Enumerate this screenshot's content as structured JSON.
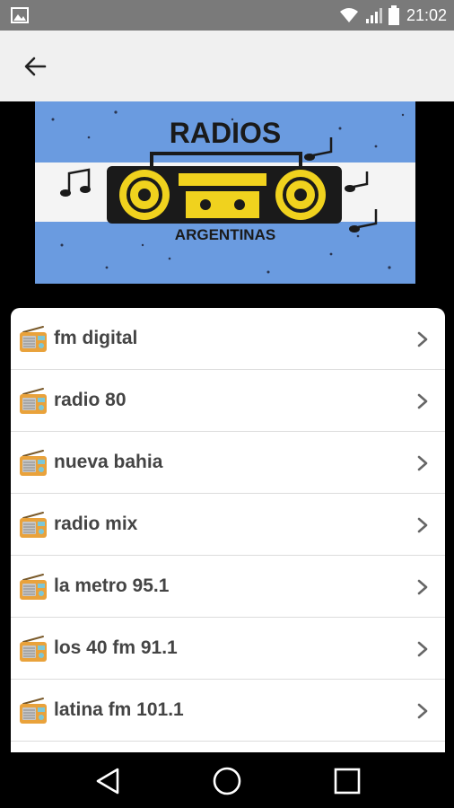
{
  "status_bar": {
    "time": "21:02",
    "icons": [
      "gallery-icon",
      "wifi-icon",
      "signal-icon",
      "battery-icon"
    ]
  },
  "app_bar": {
    "back_icon": "arrow-left-icon"
  },
  "banner": {
    "title": "RADIOS",
    "subtitle": "ARGENTINAS",
    "colors": {
      "sky": "#6a9be0",
      "white": "#f4f4f4",
      "radio": "#f0d21e"
    }
  },
  "stations": [
    {
      "label": "fm digital"
    },
    {
      "label": "radio 80"
    },
    {
      "label": "nueva bahia"
    },
    {
      "label": "radio mix"
    },
    {
      "label": "la metro 95.1"
    },
    {
      "label": "los 40 fm 91.1"
    },
    {
      "label": "latina fm 101.1"
    }
  ],
  "nav_bar": {
    "buttons": [
      "back-triangle-icon",
      "home-circle-icon",
      "recents-square-icon"
    ]
  }
}
